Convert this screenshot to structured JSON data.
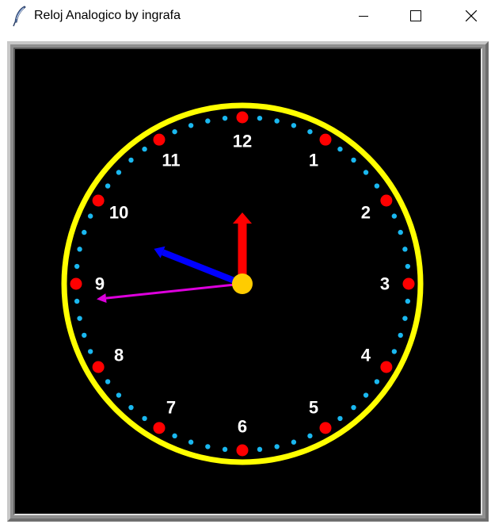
{
  "window": {
    "title": "Reloj Analogico by ingrafa",
    "app_icon": "feather-icon",
    "controls": {
      "minimize_icon": "minimize-icon",
      "maximize_icon": "maximize-icon",
      "close_icon": "close-icon"
    }
  },
  "clock": {
    "numerals": [
      "12",
      "1",
      "2",
      "3",
      "4",
      "5",
      "6",
      "7",
      "8",
      "9",
      "10",
      "11"
    ],
    "time_shown": {
      "hour": 9.72,
      "minute": 0,
      "second": 44
    },
    "colors": {
      "background": "#000000",
      "rim": "#ffff00",
      "hour_marker": "#ff0000",
      "minute_dot": "#1ab8f0",
      "numeral": "#ffffff",
      "hour_hand": "#0000ff",
      "minute_hand": "#ff0000",
      "second_hand": "#dd00dd",
      "center_cap": "#ffcc00"
    }
  }
}
